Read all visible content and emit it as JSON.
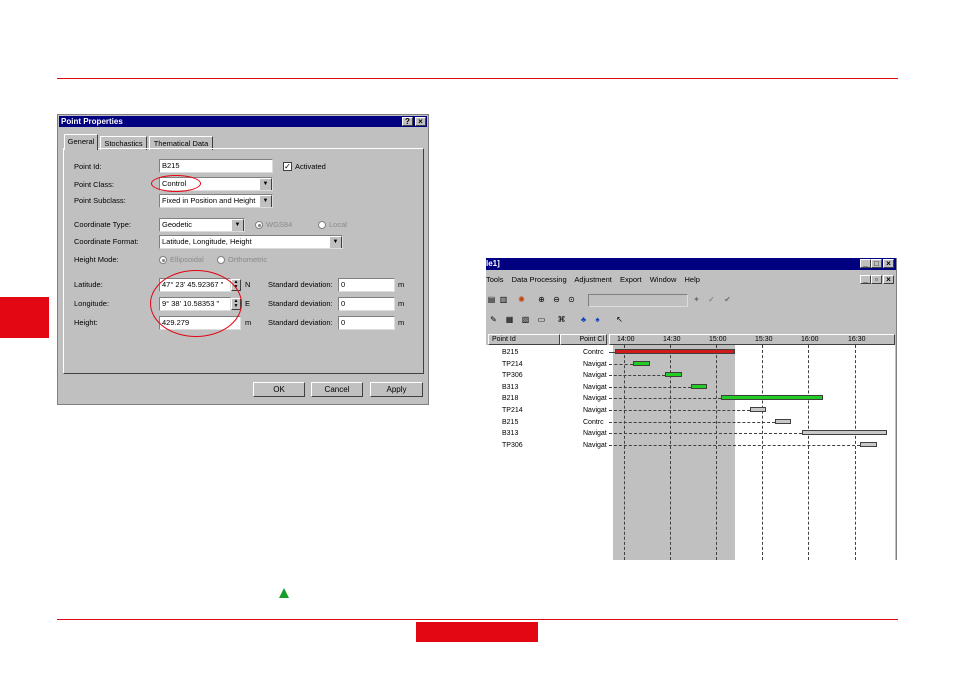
{
  "dialog": {
    "title": "Point Properties",
    "help_glyph": "?",
    "close_glyph": "×",
    "tabs": [
      "General",
      "Stochastics",
      "Thematical Data"
    ],
    "point_id": {
      "label": "Point Id:",
      "value": "B215"
    },
    "activated": {
      "label": "Activated",
      "checked": true
    },
    "point_class": {
      "label": "Point Class:",
      "value": "Control"
    },
    "point_subclass": {
      "label": "Point Subclass:",
      "value": "Fixed in Position and Height"
    },
    "coord_type": {
      "label": "Coordinate Type:",
      "value": "Geodetic",
      "opt_wgs": "WGS84",
      "opt_local": "Local"
    },
    "coord_format": {
      "label": "Coordinate Format:",
      "value": "Latitude, Longitude, Height"
    },
    "height_mode": {
      "label": "Height Mode:",
      "opt1": "Ellipsoidal",
      "opt2": "Orthometric"
    },
    "latitude": {
      "label": "Latitude:",
      "value": "47° 23' 45.92367 \"",
      "hemi": "N"
    },
    "longitude": {
      "label": "Longitude:",
      "value": "9° 38' 10.58353 \"",
      "hemi": "E"
    },
    "height": {
      "label": "Height:",
      "value": "429.279",
      "unit": "m"
    },
    "std_label": "Standard deviation:",
    "std_values": [
      "0",
      "0",
      "0"
    ],
    "std_unit": "m",
    "buttons": {
      "ok": "OK",
      "cancel": "Cancel",
      "apply": "Apply"
    }
  },
  "gantt_window": {
    "title": "le1]",
    "menu": [
      "Tools",
      "Data Processing",
      "Adjustment",
      "Export",
      "Window",
      "Help"
    ],
    "columns": {
      "point_id": "Point Id",
      "point_class": "Point Cl"
    },
    "times": [
      "14:00",
      "14:30",
      "15:00",
      "15:30",
      "16:00",
      "16:30"
    ],
    "rows": [
      {
        "id": "B215",
        "cls": "Contrc"
      },
      {
        "id": "TP214",
        "cls": "Navigat"
      },
      {
        "id": "TP306",
        "cls": "Navigat"
      },
      {
        "id": "B313",
        "cls": "Navigat"
      },
      {
        "id": "B218",
        "cls": "Navigat"
      },
      {
        "id": "TP214",
        "cls": "Navigat"
      },
      {
        "id": "B215",
        "cls": "Contrc"
      },
      {
        "id": "B313",
        "cls": "Navigat"
      },
      {
        "id": "TP306",
        "cls": "Navigat"
      }
    ],
    "colors": {
      "control_bar": "#d11a1a",
      "nav_bar": "#22cc22",
      "grey_bar": "#c8c8c8",
      "selection": "#c0c0c0"
    }
  }
}
